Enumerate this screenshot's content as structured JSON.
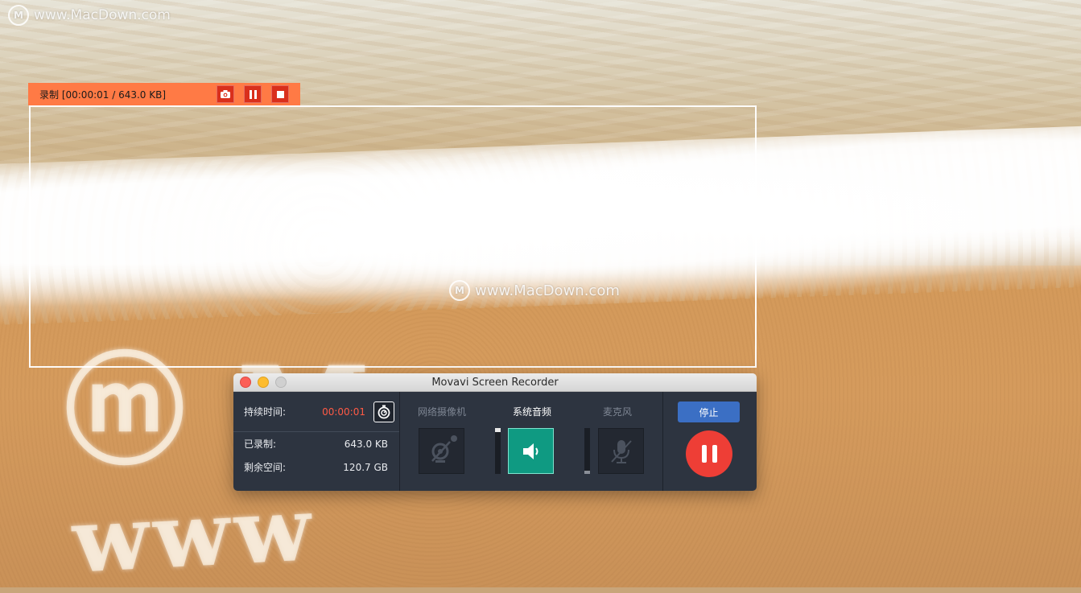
{
  "watermark": {
    "top_left": "www.MacDown.com",
    "center": "www.MacDown.com",
    "logo_letter": "M"
  },
  "recording_bar": {
    "status": "录制 [00:00:01 / 643.0 KB]",
    "buttons": [
      "screenshot-icon",
      "pause-icon",
      "stop-icon"
    ],
    "color": "#ff7a45"
  },
  "window": {
    "title": "Movavi Screen Recorder"
  },
  "stats": {
    "duration_label": "持续时间:",
    "duration_value": "00:00:01",
    "recorded_label": "已录制:",
    "recorded_value": "643.0 KB",
    "free_space_label": "剩余空间:",
    "free_space_value": "120.7 GB"
  },
  "devices": {
    "webcam_label": "网络摄像机",
    "system_audio_label": "系统音频",
    "microphone_label": "麦克风",
    "webcam_enabled": false,
    "system_audio_enabled": true,
    "microphone_enabled": false
  },
  "controls": {
    "stop_label": "停止",
    "accent_stop": "#3b6fc4",
    "accent_pause": "#ee3e36"
  }
}
